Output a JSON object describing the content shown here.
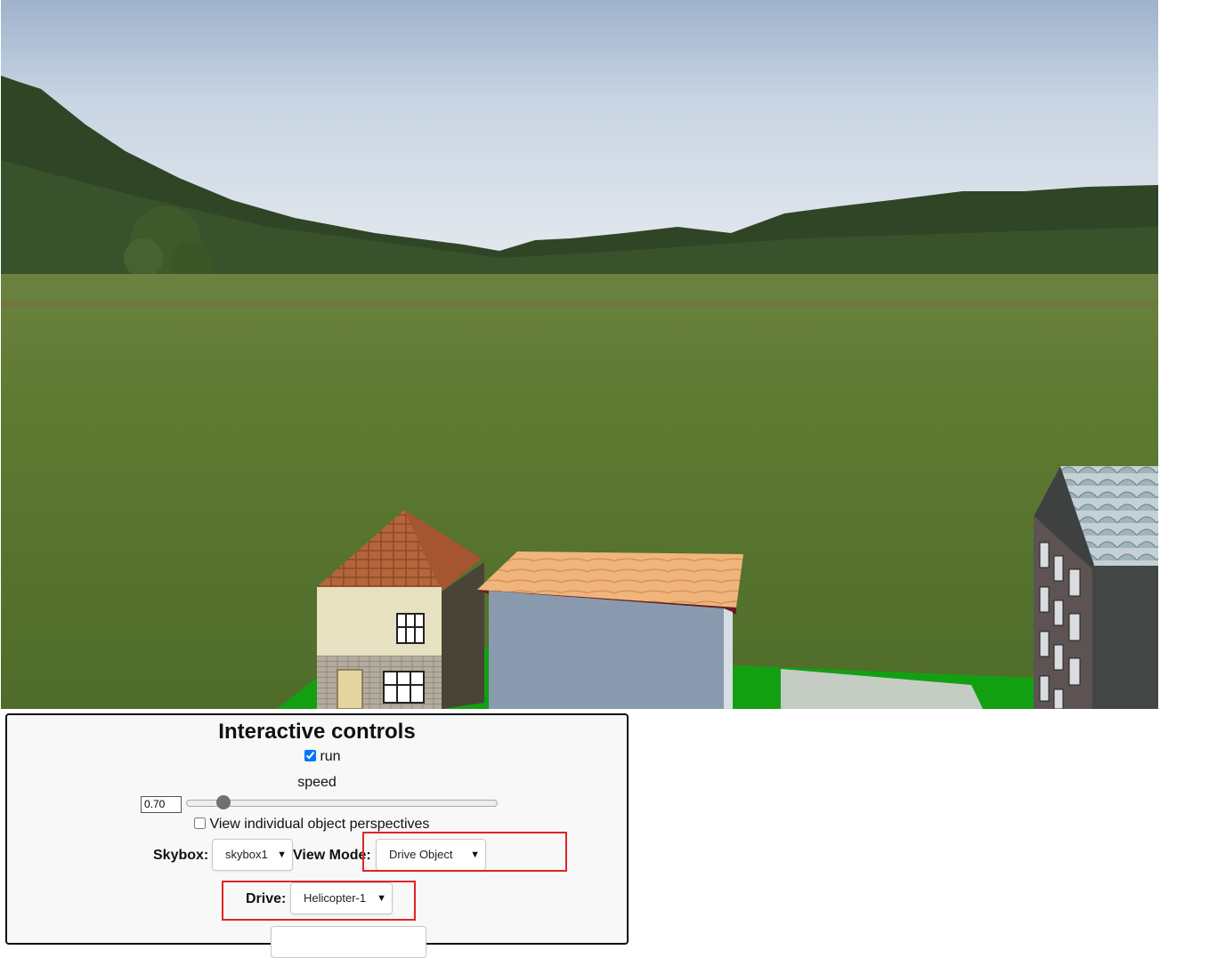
{
  "controls": {
    "title": "Interactive controls",
    "run_label": "run",
    "run_checked": true,
    "speed_label": "speed",
    "speed_value": "0.70",
    "speed_slider_fraction": 0.12,
    "perspectives_label": "View individual object perspectives",
    "perspectives_checked": false,
    "skybox_label": "Skybox:",
    "skybox_value": "skybox1",
    "view_mode_label": "View Mode:",
    "view_mode_value": "Drive Object",
    "drive_label": "Drive:",
    "drive_value": "Helicopter-1"
  },
  "scene": {
    "sky_color": "#cdd8e6",
    "grass_color": "#5d7b32",
    "ground_color": "#12a012",
    "road_color": "#c4ccc4",
    "highlight_color": "#e02424"
  }
}
